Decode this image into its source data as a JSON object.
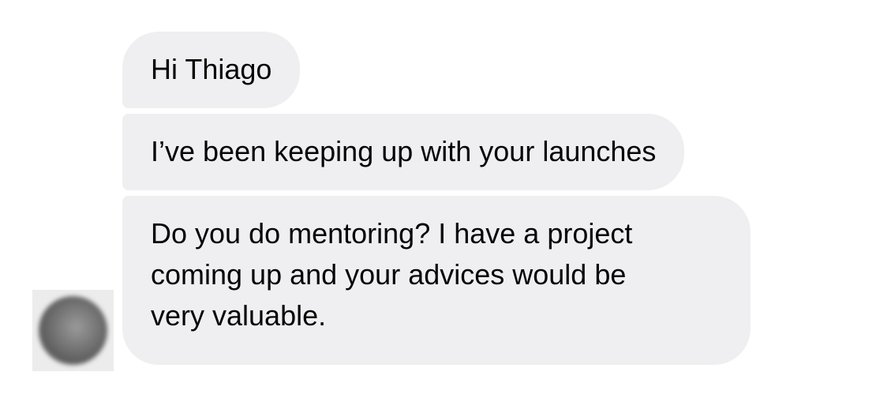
{
  "conversation": {
    "messages": [
      {
        "lines": [
          "Hi Thiago"
        ]
      },
      {
        "lines": [
          "I’ve been keeping up with your launches"
        ]
      },
      {
        "lines": [
          "Do you do mentoring? I have a project",
          "coming up and your advices would be",
          "very valuable."
        ]
      }
    ]
  },
  "colors": {
    "bubble_background": "#efeff1",
    "text": "#050505",
    "page_background": "#ffffff"
  },
  "icons": {
    "avatar": "blurred-avatar"
  }
}
